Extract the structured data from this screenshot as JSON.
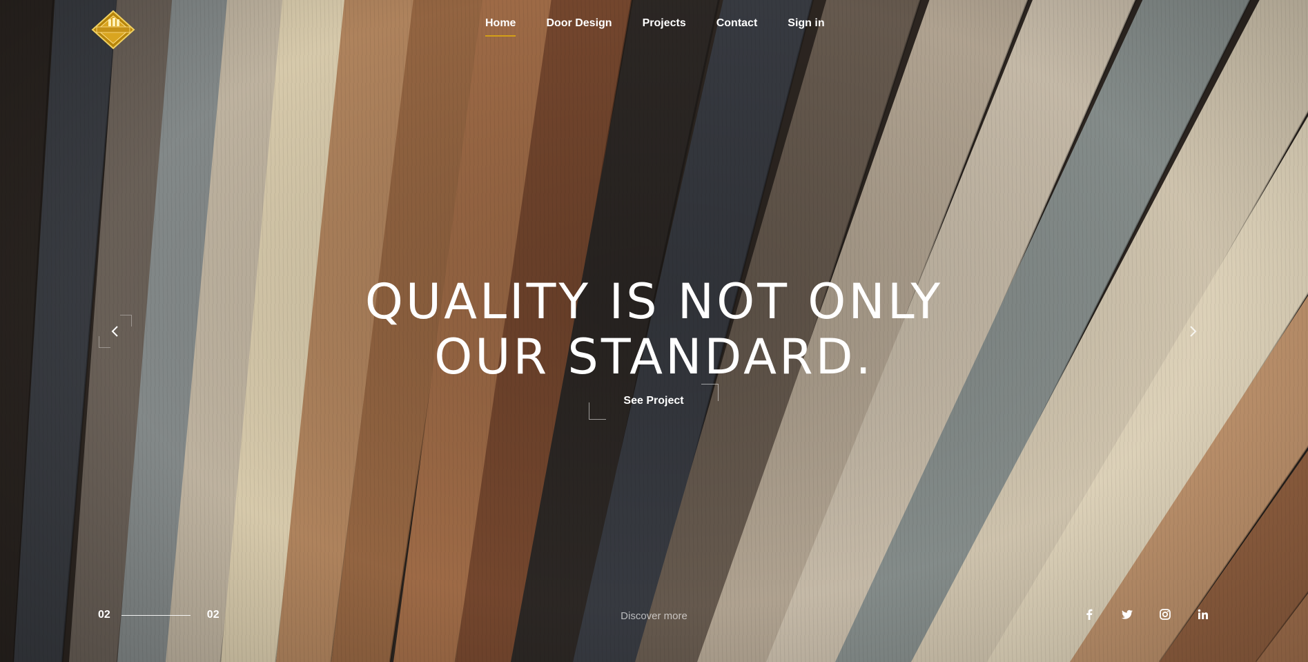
{
  "nav": {
    "items": [
      {
        "label": "Home",
        "active": true
      },
      {
        "label": "Door Design",
        "active": false
      },
      {
        "label": "Projects",
        "active": false
      },
      {
        "label": "Contact",
        "active": false
      },
      {
        "label": "Sign in",
        "active": false
      }
    ]
  },
  "hero": {
    "headline_line1": "QUALITY IS NOT ONLY",
    "headline_line2": "OUR STANDARD.",
    "cta_label": "See Project"
  },
  "slider": {
    "current": "02",
    "total": "02",
    "prev_icon": "chevron-left-icon",
    "next_icon": "chevron-right-icon"
  },
  "footer": {
    "discover_label": "Discover more",
    "social": [
      "facebook-icon",
      "twitter-icon",
      "instagram-icon",
      "linkedin-icon"
    ]
  },
  "colors": {
    "accent": "#d4a017",
    "text": "#ffffff"
  }
}
